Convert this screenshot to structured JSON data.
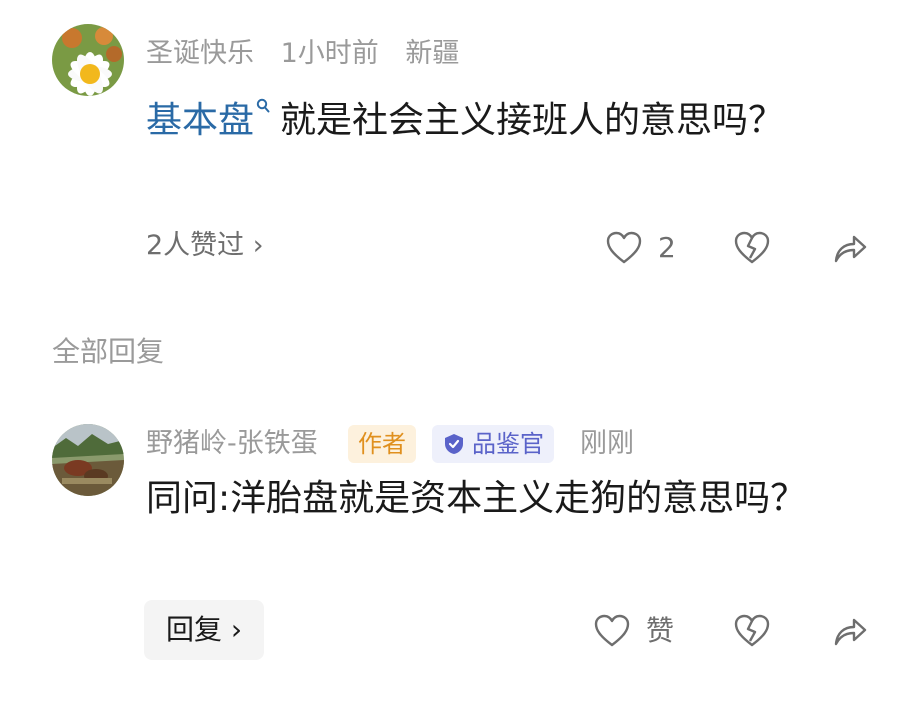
{
  "comment": {
    "username": "圣诞快乐",
    "time": "1小时前",
    "location": "新疆",
    "keyword": "基本盘",
    "text_rest": "就是社会主义接班人的意思吗？",
    "likes_summary": "2人赞过 ›",
    "like_count": "2"
  },
  "replies_section": {
    "title": "全部回复"
  },
  "reply": {
    "username": "野猪岭-张铁蛋",
    "author_badge": "作者",
    "taster_badge": "品鉴官",
    "time": "刚刚",
    "text": "同问:洋胎盘就是资本主义走狗的意思吗？",
    "reply_button": "回复 ›",
    "like_label": "赞"
  },
  "colors": {
    "keyword": "#2a6aa6",
    "meta": "#9a9a9a",
    "author_badge_bg": "#fdf1dd",
    "author_badge_text": "#e0901e",
    "taster_badge_bg": "#eef0fb",
    "taster_badge_text": "#5a63c9"
  },
  "icons": [
    "heart-outline-icon",
    "broken-heart-icon",
    "share-arrow-icon",
    "search-icon",
    "verified-shield-icon"
  ]
}
